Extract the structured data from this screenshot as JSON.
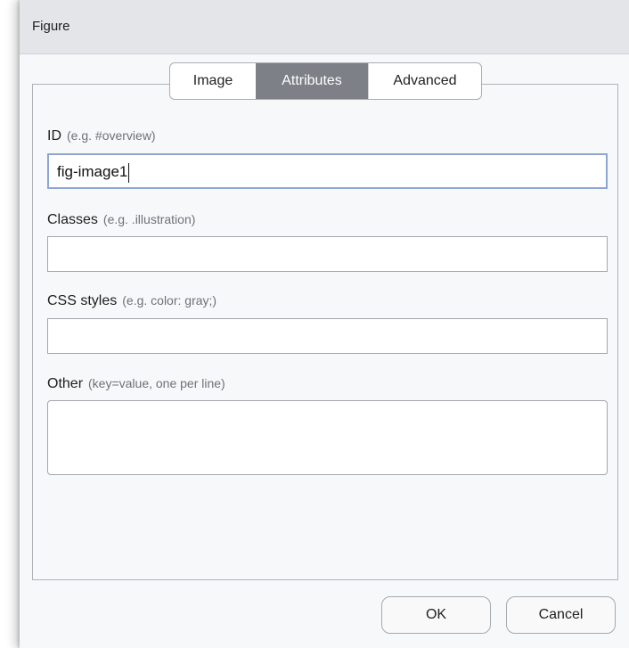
{
  "window": {
    "title": "Figure"
  },
  "tabs": [
    {
      "label": "Image",
      "selected": false
    },
    {
      "label": "Attributes",
      "selected": true
    },
    {
      "label": "Advanced",
      "selected": false
    }
  ],
  "fields": {
    "id": {
      "label": "ID",
      "hint": "(e.g. #overview)",
      "value": "fig-image1"
    },
    "classes": {
      "label": "Classes",
      "hint": "(e.g. .illustration)",
      "value": ""
    },
    "css": {
      "label": "CSS styles",
      "hint": "(e.g. color: gray;)",
      "value": ""
    },
    "other": {
      "label": "Other",
      "hint": "(key=value, one per line)",
      "value": ""
    }
  },
  "buttons": {
    "ok": "OK",
    "cancel": "Cancel"
  },
  "colors": {
    "tab_selected_bg": "#7d8086",
    "focus_border": "#8fa6d2",
    "dialog_bg": "#f7f8fa"
  }
}
